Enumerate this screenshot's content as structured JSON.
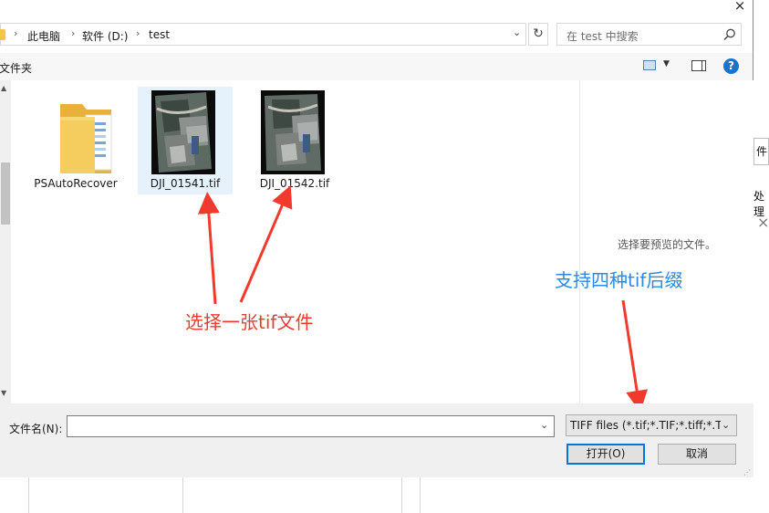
{
  "background": {
    "edge_button_1": "件",
    "edge_button_2": "处理",
    "edge_close": "×"
  },
  "dialog": {
    "close": "×",
    "address": {
      "crumbs": [
        "此电脑",
        "软件 (D:)",
        "test"
      ],
      "separator": "›",
      "dropdown": "⌄",
      "refresh": "↻"
    },
    "search": {
      "placeholder": "在 test 中搜索"
    },
    "toolbar": {
      "new_folder_label": "文件夹",
      "help": "?"
    },
    "files": [
      {
        "name": "PSAutoRecover",
        "type": "folder"
      },
      {
        "name": "DJI_01541.tif",
        "type": "tif",
        "selected": true
      },
      {
        "name": "DJI_01542.tif",
        "type": "tif",
        "selected": false
      }
    ],
    "preview_text": "选择要预览的文件。",
    "annotations": {
      "red_text": "选择一张tif文件",
      "blue_text": "支持四种tif后缀",
      "red_color": "#f03a2e",
      "blue_color": "#2b8ae6"
    },
    "bottom": {
      "filename_label": "文件名(N):",
      "filename_value": "",
      "filetype_value": "TIFF files (*.tif;*.TIF;*.tiff;*.TIFF)",
      "open_label": "打开(O)",
      "cancel_label": "取消"
    },
    "colors": {
      "selection": "#e5f1fb",
      "accent": "#0078d7",
      "help": "#1e73c8"
    }
  }
}
